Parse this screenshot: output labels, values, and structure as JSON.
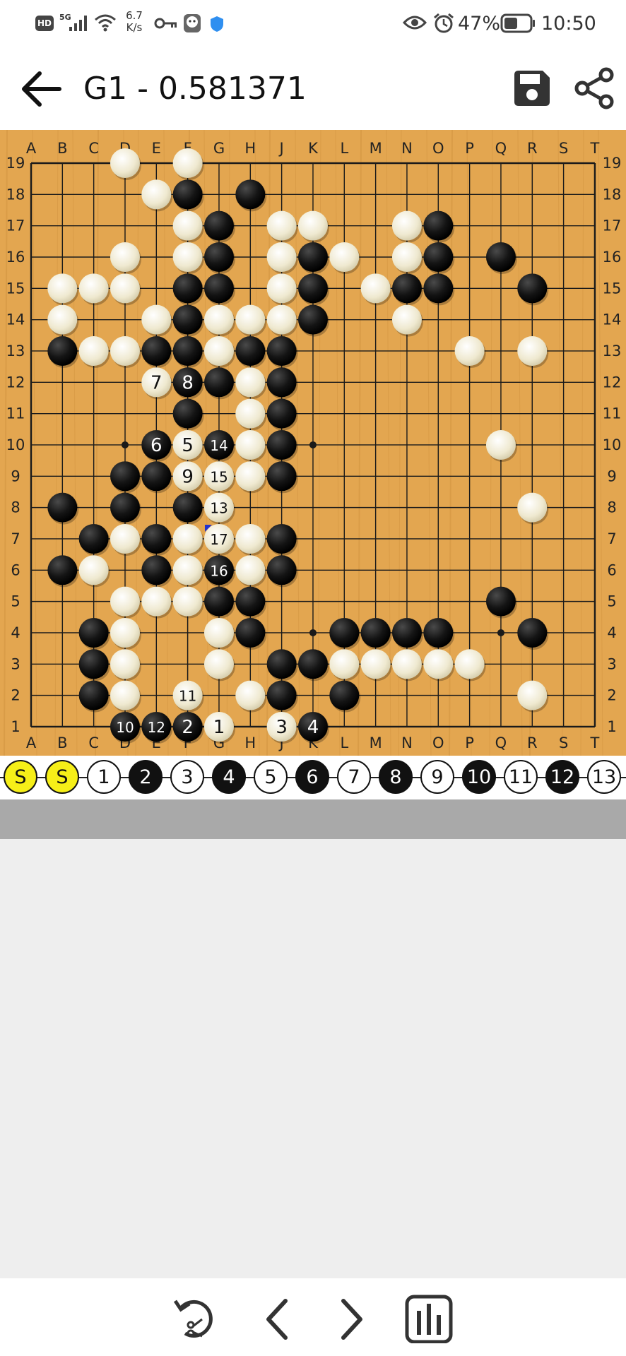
{
  "status_bar": {
    "hd": "HD",
    "net_type": "5G",
    "speed_value": "6.7",
    "speed_unit": "K/s",
    "battery": "47%",
    "time": "10:50"
  },
  "header": {
    "title": "G1 - 0.581371"
  },
  "board": {
    "size": 19,
    "columns": [
      "A",
      "B",
      "C",
      "D",
      "E",
      "F",
      "G",
      "H",
      "J",
      "K",
      "L",
      "M",
      "N",
      "O",
      "P",
      "Q",
      "R",
      "S",
      "T"
    ],
    "rows": [
      "19",
      "18",
      "17",
      "16",
      "15",
      "14",
      "13",
      "12",
      "11",
      "10",
      "9",
      "8",
      "7",
      "6",
      "5",
      "4",
      "3",
      "2",
      "1"
    ],
    "colors": {
      "board": "#e3a650",
      "line": "#1a1a1a",
      "black_stone": "#111111",
      "white_stone": "#f1edd8",
      "last_move_marker": "#2233cc"
    },
    "hoshi": [
      "D16",
      "K16",
      "Q16",
      "D10",
      "K10",
      "Q10",
      "D4",
      "K4",
      "Q4"
    ],
    "stones": [
      {
        "p": "D19",
        "c": "w"
      },
      {
        "p": "F19",
        "c": "w"
      },
      {
        "p": "E18",
        "c": "w"
      },
      {
        "p": "F18",
        "c": "b"
      },
      {
        "p": "H18",
        "c": "b"
      },
      {
        "p": "F17",
        "c": "w"
      },
      {
        "p": "G17",
        "c": "b"
      },
      {
        "p": "J17",
        "c": "w"
      },
      {
        "p": "K17",
        "c": "w"
      },
      {
        "p": "N17",
        "c": "w"
      },
      {
        "p": "O17",
        "c": "b"
      },
      {
        "p": "D16",
        "c": "w"
      },
      {
        "p": "F16",
        "c": "w"
      },
      {
        "p": "G16",
        "c": "b"
      },
      {
        "p": "J16",
        "c": "w"
      },
      {
        "p": "K16",
        "c": "b"
      },
      {
        "p": "L16",
        "c": "w"
      },
      {
        "p": "N16",
        "c": "w"
      },
      {
        "p": "O16",
        "c": "b"
      },
      {
        "p": "Q16",
        "c": "b"
      },
      {
        "p": "B15",
        "c": "w"
      },
      {
        "p": "C15",
        "c": "w"
      },
      {
        "p": "D15",
        "c": "w"
      },
      {
        "p": "F15",
        "c": "b"
      },
      {
        "p": "G15",
        "c": "b"
      },
      {
        "p": "J15",
        "c": "w"
      },
      {
        "p": "K15",
        "c": "b"
      },
      {
        "p": "M15",
        "c": "w"
      },
      {
        "p": "N15",
        "c": "b"
      },
      {
        "p": "O15",
        "c": "b"
      },
      {
        "p": "R15",
        "c": "b"
      },
      {
        "p": "B14",
        "c": "w"
      },
      {
        "p": "E14",
        "c": "w"
      },
      {
        "p": "F14",
        "c": "b"
      },
      {
        "p": "G14",
        "c": "w"
      },
      {
        "p": "H14",
        "c": "w"
      },
      {
        "p": "J14",
        "c": "w"
      },
      {
        "p": "K14",
        "c": "b"
      },
      {
        "p": "N14",
        "c": "w"
      },
      {
        "p": "B13",
        "c": "b"
      },
      {
        "p": "C13",
        "c": "w"
      },
      {
        "p": "D13",
        "c": "w"
      },
      {
        "p": "E13",
        "c": "b"
      },
      {
        "p": "F13",
        "c": "b"
      },
      {
        "p": "G13",
        "c": "w"
      },
      {
        "p": "H13",
        "c": "b"
      },
      {
        "p": "J13",
        "c": "b"
      },
      {
        "p": "P13",
        "c": "w"
      },
      {
        "p": "R13",
        "c": "w"
      },
      {
        "p": "E12",
        "c": "w",
        "n": "7"
      },
      {
        "p": "F12",
        "c": "b",
        "n": "8"
      },
      {
        "p": "G12",
        "c": "b"
      },
      {
        "p": "H12",
        "c": "w"
      },
      {
        "p": "J12",
        "c": "b"
      },
      {
        "p": "F11",
        "c": "b"
      },
      {
        "p": "H11",
        "c": "w"
      },
      {
        "p": "J11",
        "c": "b"
      },
      {
        "p": "E10",
        "c": "b",
        "n": "6"
      },
      {
        "p": "F10",
        "c": "w",
        "n": "5"
      },
      {
        "p": "G10",
        "c": "b",
        "n": "14"
      },
      {
        "p": "H10",
        "c": "w"
      },
      {
        "p": "J10",
        "c": "b"
      },
      {
        "p": "Q10",
        "c": "w"
      },
      {
        "p": "D9",
        "c": "b"
      },
      {
        "p": "E9",
        "c": "b"
      },
      {
        "p": "F9",
        "c": "w",
        "n": "9"
      },
      {
        "p": "G9",
        "c": "w",
        "n": "15"
      },
      {
        "p": "H9",
        "c": "w"
      },
      {
        "p": "J9",
        "c": "b"
      },
      {
        "p": "B8",
        "c": "b"
      },
      {
        "p": "D8",
        "c": "b"
      },
      {
        "p": "F8",
        "c": "b"
      },
      {
        "p": "G8",
        "c": "w",
        "n": "13"
      },
      {
        "p": "R8",
        "c": "w"
      },
      {
        "p": "C7",
        "c": "b"
      },
      {
        "p": "D7",
        "c": "w"
      },
      {
        "p": "E7",
        "c": "b"
      },
      {
        "p": "F7",
        "c": "w"
      },
      {
        "p": "G7",
        "c": "w",
        "n": "17",
        "last": true
      },
      {
        "p": "H7",
        "c": "w"
      },
      {
        "p": "J7",
        "c": "b"
      },
      {
        "p": "B6",
        "c": "b"
      },
      {
        "p": "C6",
        "c": "w"
      },
      {
        "p": "E6",
        "c": "b"
      },
      {
        "p": "F6",
        "c": "w"
      },
      {
        "p": "G6",
        "c": "b",
        "n": "16"
      },
      {
        "p": "H6",
        "c": "w"
      },
      {
        "p": "J6",
        "c": "b"
      },
      {
        "p": "D5",
        "c": "w"
      },
      {
        "p": "E5",
        "c": "w"
      },
      {
        "p": "F5",
        "c": "w"
      },
      {
        "p": "G5",
        "c": "b"
      },
      {
        "p": "H5",
        "c": "b"
      },
      {
        "p": "Q5",
        "c": "b"
      },
      {
        "p": "C4",
        "c": "b"
      },
      {
        "p": "D4",
        "c": "w"
      },
      {
        "p": "G4",
        "c": "w"
      },
      {
        "p": "H4",
        "c": "b"
      },
      {
        "p": "L4",
        "c": "b"
      },
      {
        "p": "M4",
        "c": "b"
      },
      {
        "p": "N4",
        "c": "b"
      },
      {
        "p": "O4",
        "c": "b"
      },
      {
        "p": "R4",
        "c": "b"
      },
      {
        "p": "C3",
        "c": "b"
      },
      {
        "p": "D3",
        "c": "w"
      },
      {
        "p": "G3",
        "c": "w"
      },
      {
        "p": "J3",
        "c": "b"
      },
      {
        "p": "K3",
        "c": "b"
      },
      {
        "p": "L3",
        "c": "w"
      },
      {
        "p": "M3",
        "c": "w"
      },
      {
        "p": "N3",
        "c": "w"
      },
      {
        "p": "O3",
        "c": "w"
      },
      {
        "p": "P3",
        "c": "w"
      },
      {
        "p": "C2",
        "c": "b"
      },
      {
        "p": "D2",
        "c": "w"
      },
      {
        "p": "F2",
        "c": "w",
        "n": "11"
      },
      {
        "p": "H2",
        "c": "w"
      },
      {
        "p": "J2",
        "c": "b"
      },
      {
        "p": "L2",
        "c": "b"
      },
      {
        "p": "R2",
        "c": "w"
      },
      {
        "p": "D1",
        "c": "b",
        "n": "10"
      },
      {
        "p": "E1",
        "c": "b",
        "n": "12"
      },
      {
        "p": "F1",
        "c": "b",
        "n": "2"
      },
      {
        "p": "G1",
        "c": "w",
        "n": "1"
      },
      {
        "p": "J1",
        "c": "w",
        "n": "3"
      },
      {
        "p": "K1",
        "c": "b",
        "n": "4"
      }
    ]
  },
  "move_bar": {
    "items": [
      {
        "label": "S",
        "kind": "start"
      },
      {
        "label": "S",
        "kind": "start"
      },
      {
        "label": "1",
        "kind": "white"
      },
      {
        "label": "2",
        "kind": "black"
      },
      {
        "label": "3",
        "kind": "white"
      },
      {
        "label": "4",
        "kind": "black"
      },
      {
        "label": "5",
        "kind": "white"
      },
      {
        "label": "6",
        "kind": "black"
      },
      {
        "label": "7",
        "kind": "white"
      },
      {
        "label": "8",
        "kind": "black"
      },
      {
        "label": "9",
        "kind": "white"
      },
      {
        "label": "10",
        "kind": "black"
      },
      {
        "label": "11",
        "kind": "white"
      },
      {
        "label": "12",
        "kind": "black"
      },
      {
        "label": "13",
        "kind": "white"
      }
    ]
  },
  "icons": {
    "back": "arrow-left-icon",
    "save": "floppy-disk-icon",
    "share": "share-icon",
    "undo": "undo-scissors-icon",
    "prev": "chevron-left-icon",
    "next": "chevron-right-icon",
    "analysis": "bar-chart-icon"
  }
}
